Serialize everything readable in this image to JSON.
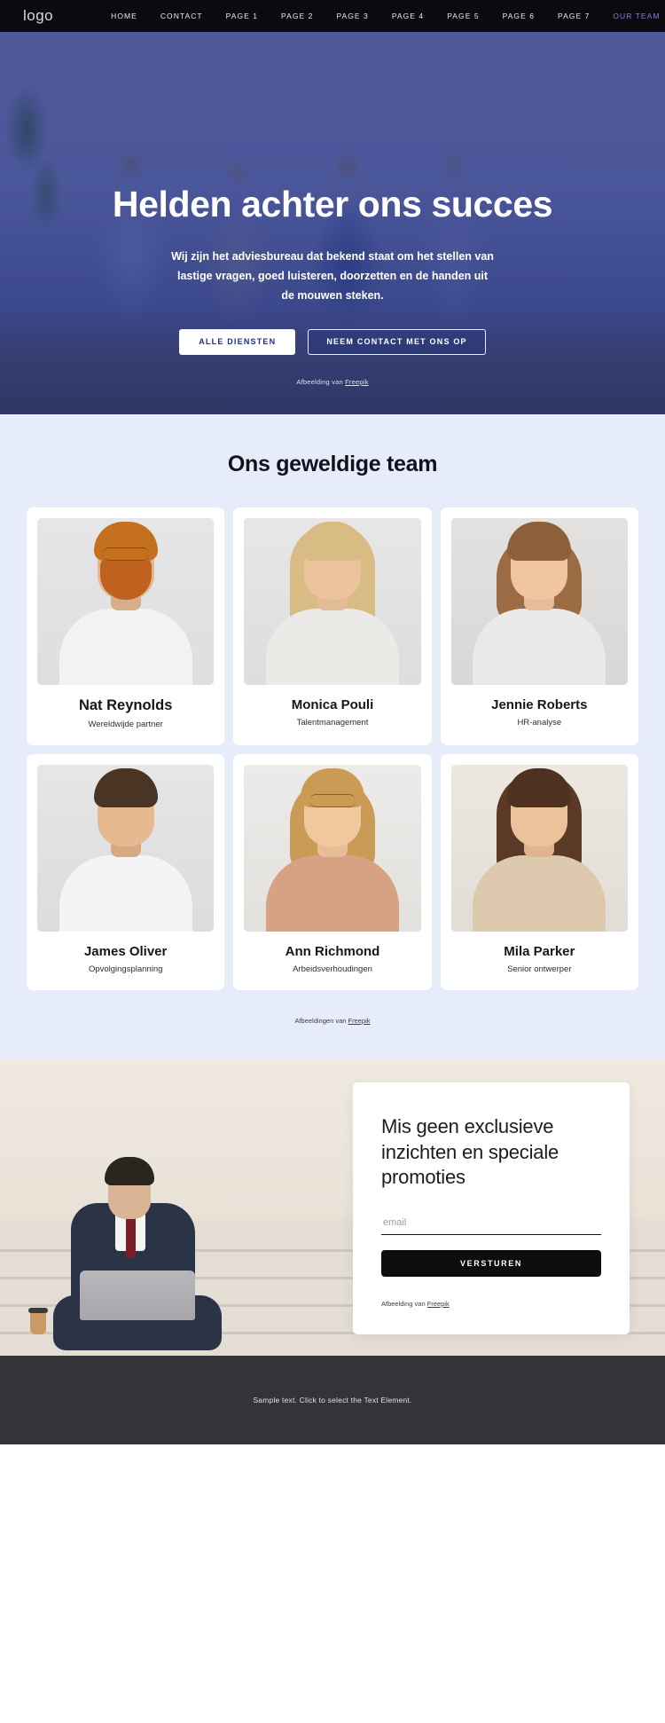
{
  "nav": {
    "logo": "logo",
    "links": [
      {
        "label": "HOME",
        "active": false
      },
      {
        "label": "CONTACT",
        "active": false
      },
      {
        "label": "PAGE 1",
        "active": false
      },
      {
        "label": "PAGE 2",
        "active": false
      },
      {
        "label": "PAGE 3",
        "active": false
      },
      {
        "label": "PAGE 4",
        "active": false
      },
      {
        "label": "PAGE 5",
        "active": false
      },
      {
        "label": "PAGE 6",
        "active": false
      },
      {
        "label": "PAGE 7",
        "active": false
      },
      {
        "label": "OUR TEAM",
        "active": true
      }
    ],
    "active_color": "#7b83e8",
    "background": "#0b0b0f"
  },
  "hero": {
    "title": "Helden achter ons succes",
    "subtitle": "Wij zijn het adviesbureau dat bekend staat om het stellen van lastige vragen, goed luisteren, doorzetten en de handen uit de mouwen steken.",
    "primary_button": "ALLE DIENSTEN",
    "secondary_button": "NEEM CONTACT MET ONS OP",
    "credit_prefix": "Afbeelding van ",
    "credit_link": "Freepik",
    "overlay_color": "#2c3a88"
  },
  "team": {
    "title": "Ons geweldige team",
    "background": "#e7ecfb",
    "credit_prefix": "Afbeeldingen van ",
    "credit_link": "Freepik",
    "members": [
      {
        "name": "Nat Reynolds",
        "role": "Wereldwijde partner"
      },
      {
        "name": "Monica Pouli",
        "role": "Talentmanagement"
      },
      {
        "name": "Jennie Roberts",
        "role": "HR-analyse"
      },
      {
        "name": "James Oliver",
        "role": "Opvolgingsplanning"
      },
      {
        "name": "Ann Richmond",
        "role": "Arbeidsverhoudingen"
      },
      {
        "name": "Mila Parker",
        "role": "Senior ontwerper"
      }
    ]
  },
  "cta": {
    "title": "Mis geen exclusieve inzichten en speciale promoties",
    "email_placeholder": "email",
    "email_value": "",
    "submit_label": "VERSTUREN",
    "credit_prefix": "Afbeelding van ",
    "credit_link": "Freepik"
  },
  "footer": {
    "text": "Sample text. Click to select the Text Element.",
    "background": "#333338"
  }
}
